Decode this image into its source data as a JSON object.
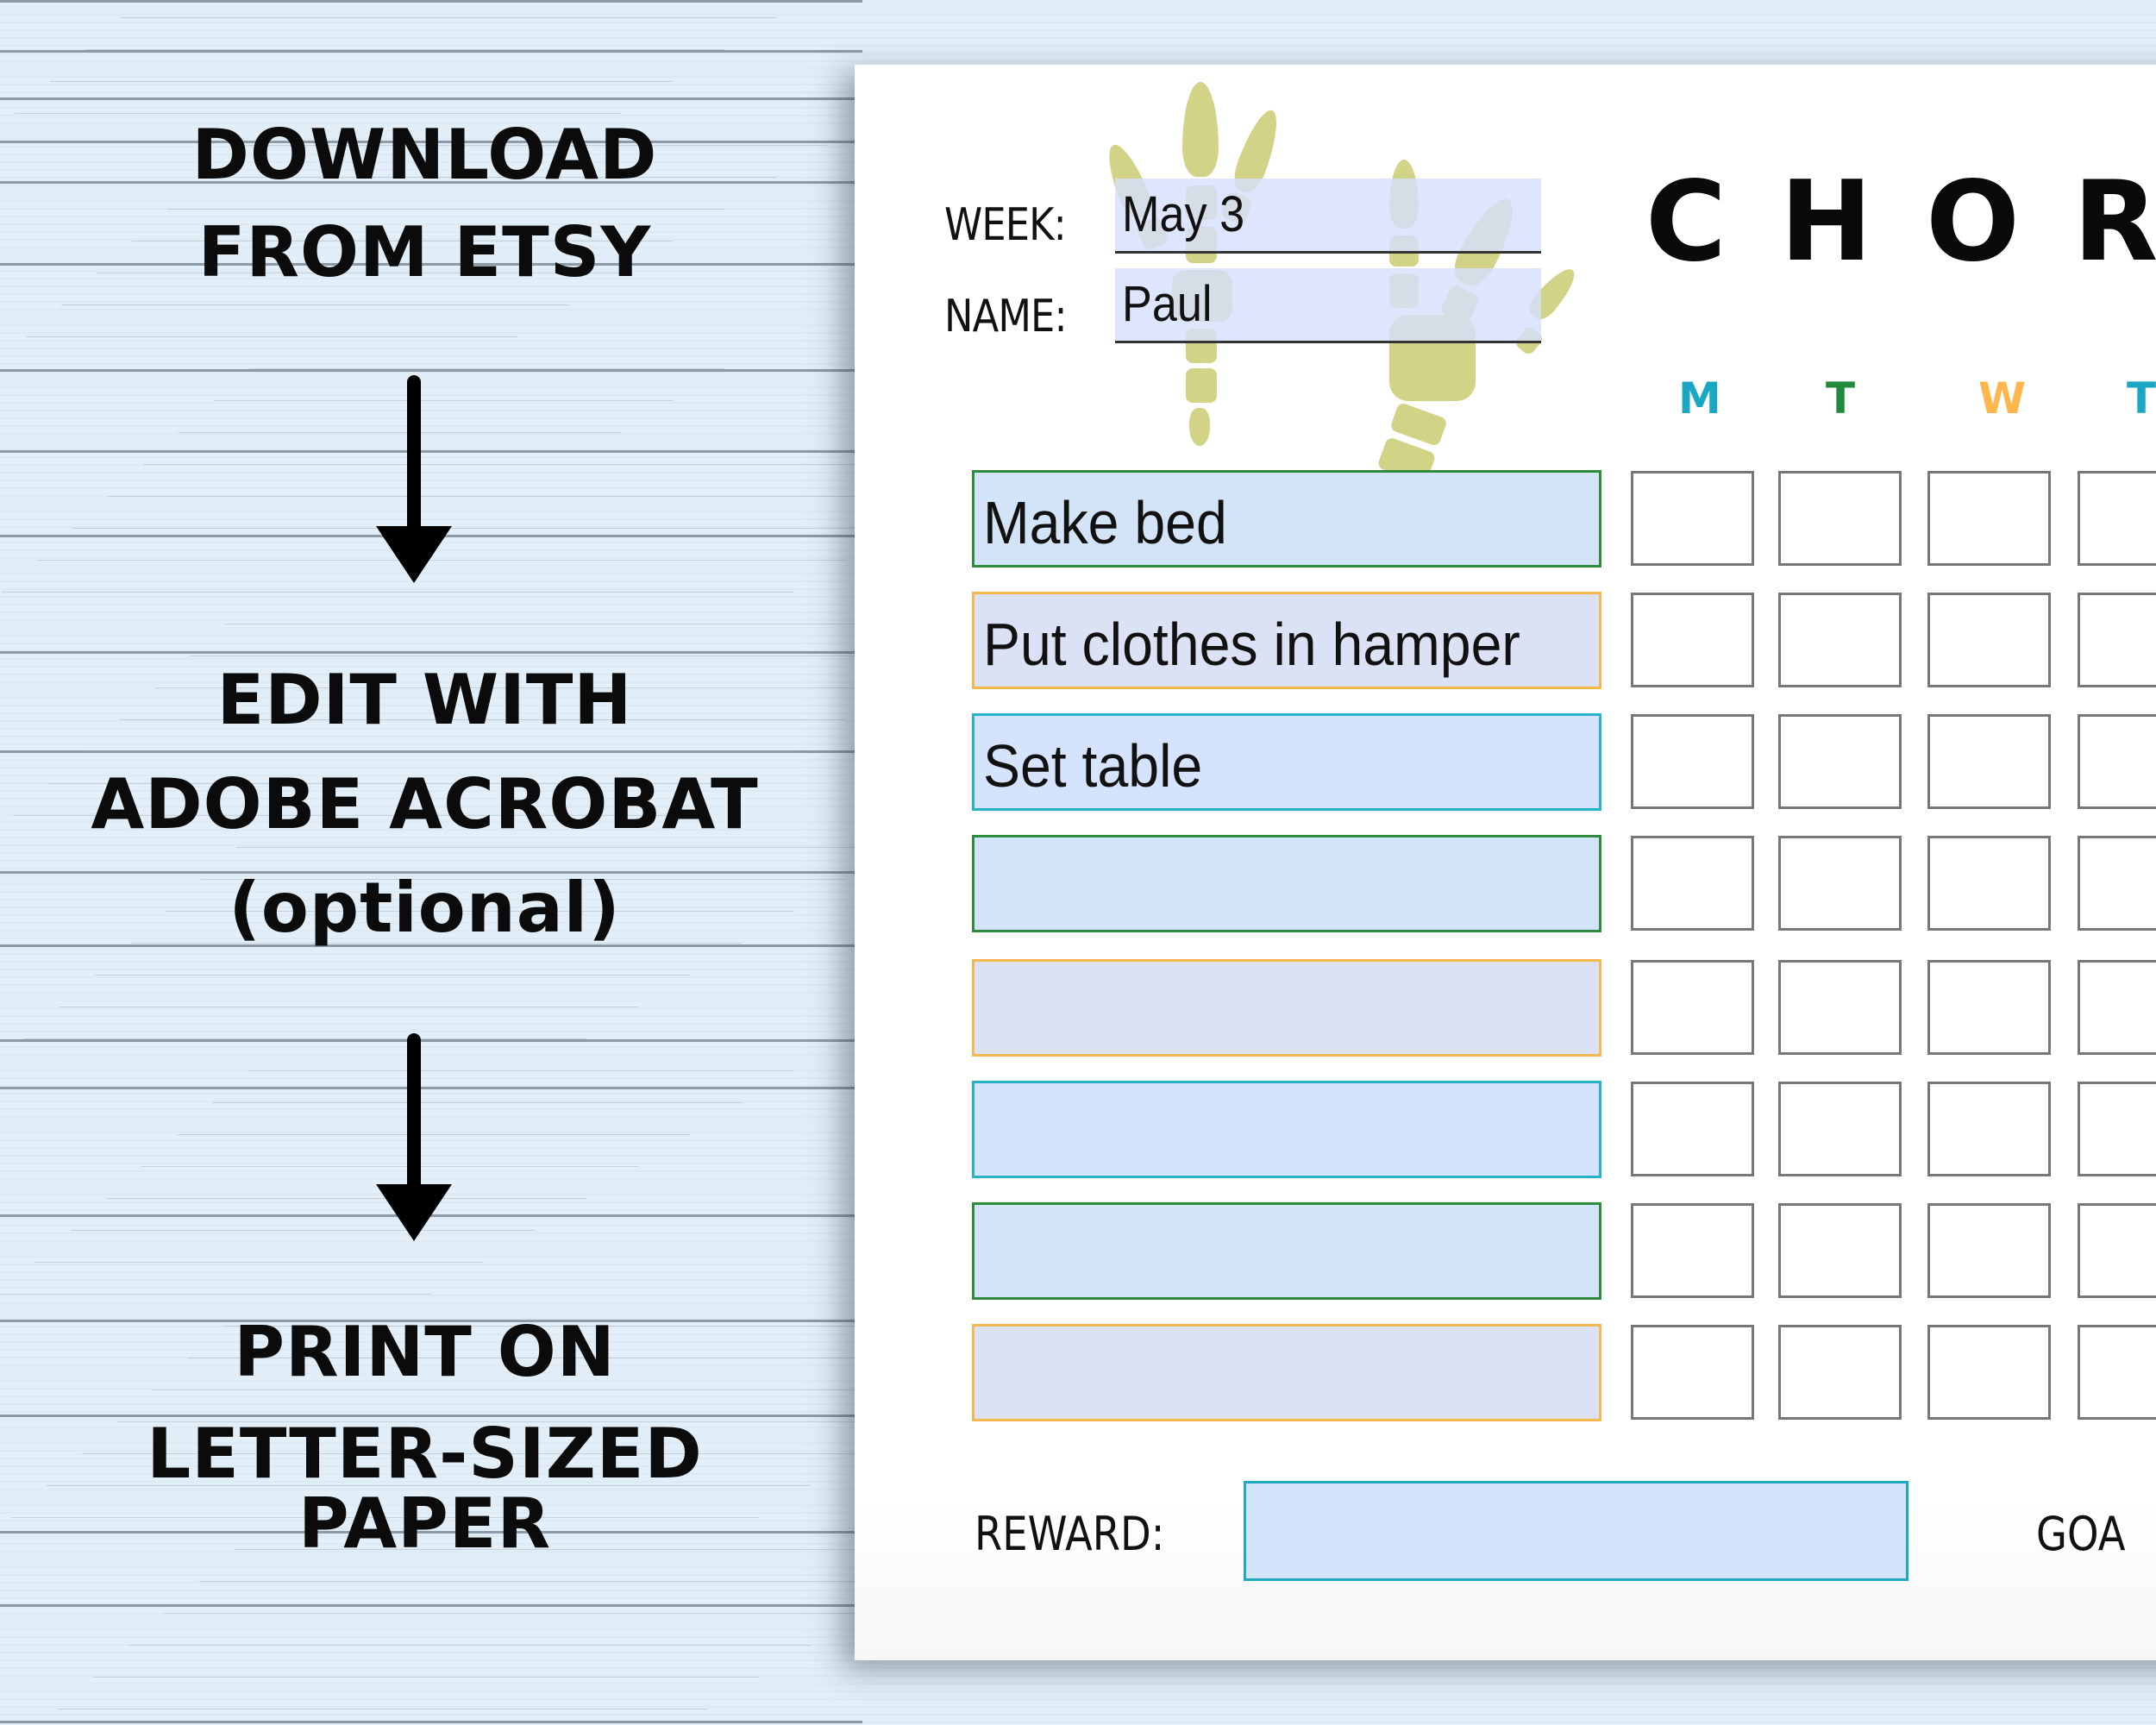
{
  "instructions": {
    "steps": [
      {
        "lines": [
          "DOWNLOAD",
          "FROM ETSY"
        ]
      },
      {
        "lines": [
          "EDIT WITH",
          "ADOBE ACROBAT",
          "(optional)"
        ]
      },
      {
        "lines": [
          "PRINT ON",
          "LETTER-SIZED",
          "PAPER"
        ]
      }
    ],
    "arrow_icon": "arrow-down-icon"
  },
  "chart_sheet": {
    "title": "CHORE",
    "week": {
      "label": "WEEK:",
      "value": "May 3"
    },
    "name": {
      "label": "NAME:",
      "value": "Paul"
    },
    "days": [
      {
        "letter": "M",
        "color": "#1aa7c4"
      },
      {
        "letter": "T",
        "color": "#1f8a3c"
      },
      {
        "letter": "W",
        "color": "#ffb74d"
      },
      {
        "letter": "T",
        "color": "#1aa7c4"
      }
    ],
    "chores": [
      {
        "text": "Make bed",
        "border": "#2e8b3e",
        "fill": "#d3e3f8"
      },
      {
        "text": "Put clothes in hamper",
        "border": "#f5b84e",
        "fill": "#dce2f5"
      },
      {
        "text": "Set table",
        "border": "#26b3c7",
        "fill": "#d5e4fc"
      },
      {
        "text": "",
        "border": "#2e8b3e",
        "fill": "#d3e3f8"
      },
      {
        "text": "",
        "border": "#f5b84e",
        "fill": "#dce2f5"
      },
      {
        "text": "",
        "border": "#26b3c7",
        "fill": "#d5e4fc"
      },
      {
        "text": "",
        "border": "#2e8b3e",
        "fill": "#d3e3f8"
      },
      {
        "text": "",
        "border": "#f5b84e",
        "fill": "#dce2f5"
      }
    ],
    "reward": {
      "label": "REWARD:",
      "value": ""
    },
    "goal": {
      "label": "GOA"
    }
  }
}
